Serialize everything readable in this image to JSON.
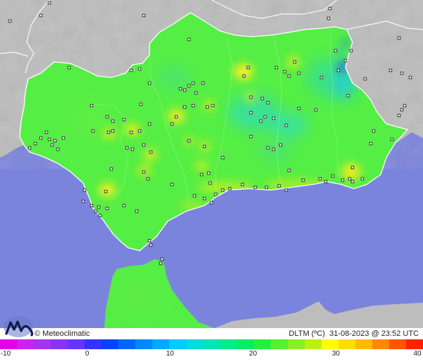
{
  "footer": {
    "credit": "© Meteoclimatic",
    "variable": "DLTM (ºC)",
    "date": "31-08-2023",
    "time": "23:52 UTC",
    "logo_icon": "meteoclimatic-logo"
  },
  "legend": {
    "min": -10,
    "max": 40,
    "ticks": [
      "-10",
      "0",
      "10",
      "20",
      "30",
      "40"
    ],
    "colors": [
      "#e600e6",
      "#cc22ee",
      "#a833ee",
      "#8a33f5",
      "#6633ff",
      "#3333ff",
      "#0044ff",
      "#0066ff",
      "#0088ff",
      "#00aaff",
      "#00ccff",
      "#00dddd",
      "#00e6b8",
      "#00ee88",
      "#00f060",
      "#22f040",
      "#55f030",
      "#88f020",
      "#bbf010",
      "#ffff00",
      "#ffdd00",
      "#ffbb00",
      "#ff8800",
      "#ff5500",
      "#ff2200"
    ]
  },
  "colors": {
    "sea": "#7b84dc",
    "land_outside": "#bdbdbd",
    "region": "#55ee44"
  }
}
